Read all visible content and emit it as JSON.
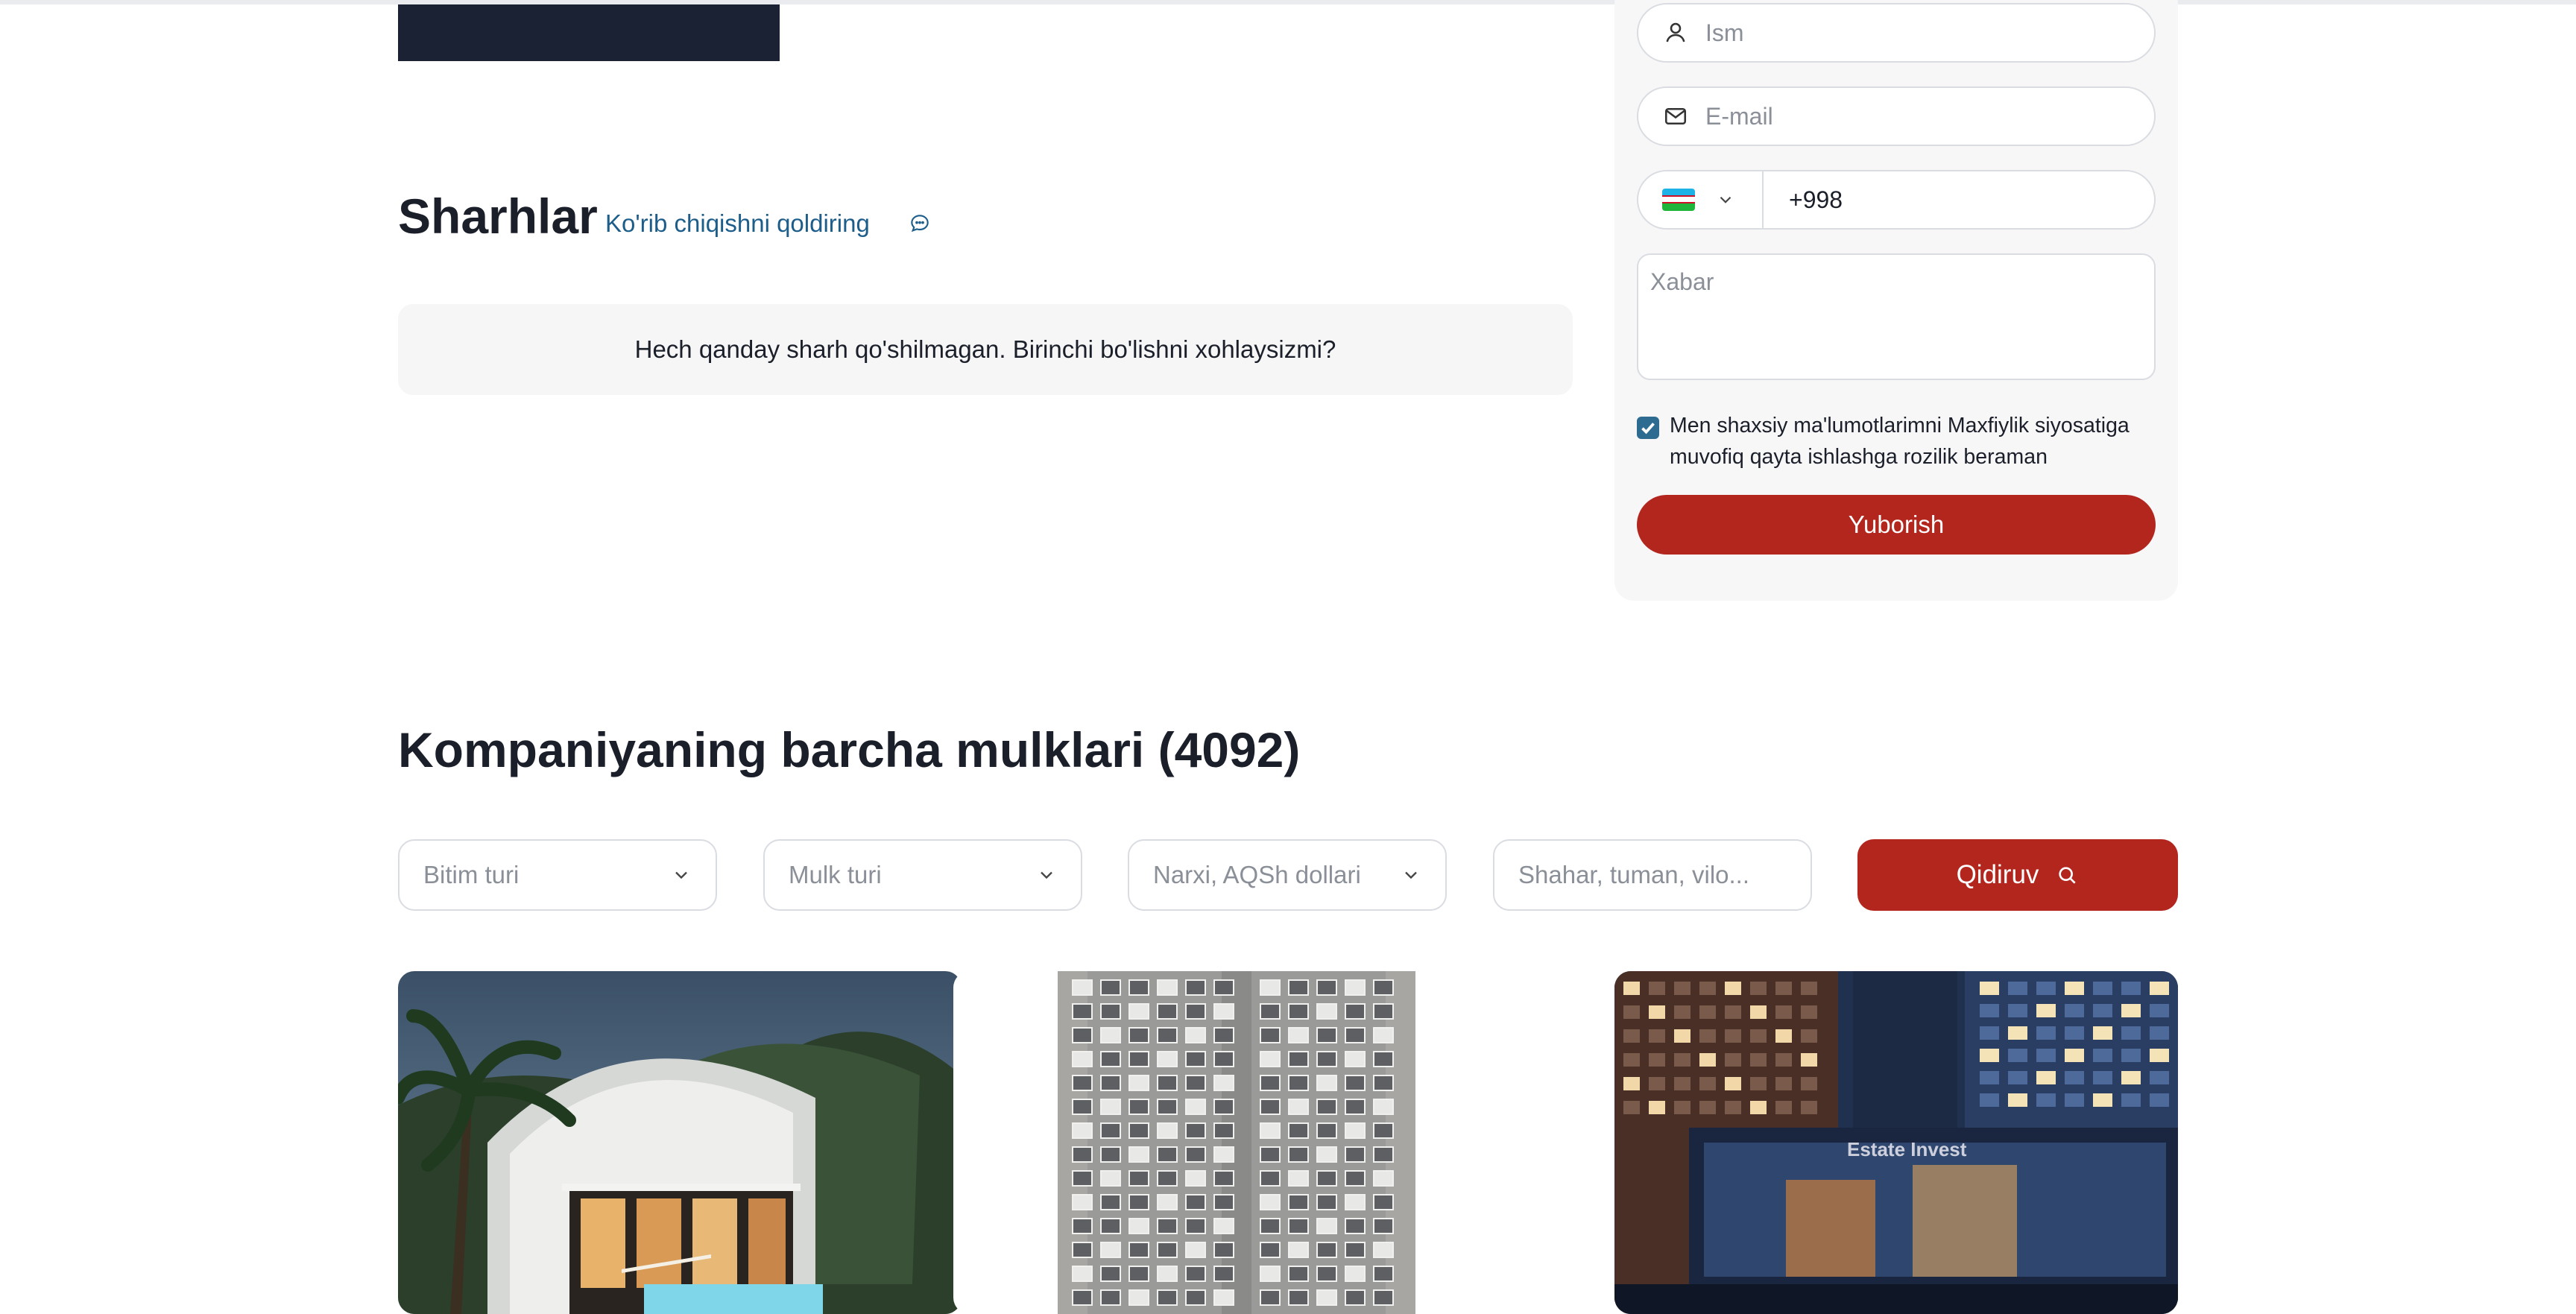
{
  "reviews": {
    "title": "Sharhlar",
    "leave_review_link": "Ko'rib chiqishni qoldiring",
    "empty_message": "Hech qanday sharh qo'shilmagan. Birinchi bo'lishni xohlaysizmi?"
  },
  "contact_form": {
    "name_placeholder": "Ism",
    "email_placeholder": "E-mail",
    "phone_prefix": "+998",
    "message_placeholder": "Xabar",
    "consent_checked": true,
    "consent_text": "Men shaxsiy ma'lumotlarimni Maxfiylik siyosatiga muvofiq qayta ishlashga rozilik beraman",
    "submit_label": "Yuborish"
  },
  "properties": {
    "title": "Kompaniyaning barcha mulklari (4092)",
    "filters": {
      "deal_type": "Bitim turi",
      "property_type": "Mulk turi",
      "price": "Narxi, AQSh dollari",
      "location_placeholder": "Shahar, tuman, vilo..."
    },
    "search_label": "Qidiruv",
    "cards": [
      {
        "image": "modern-villa-photo"
      },
      {
        "image": "apartment-tower-photo"
      },
      {
        "image": "office-building-photo",
        "watermark": "Estate Invest"
      }
    ]
  },
  "colors": {
    "accent": "#b3261e",
    "link": "#1d5d8a",
    "checkbox": "#2e6b91",
    "dark_block": "#1a2233"
  }
}
